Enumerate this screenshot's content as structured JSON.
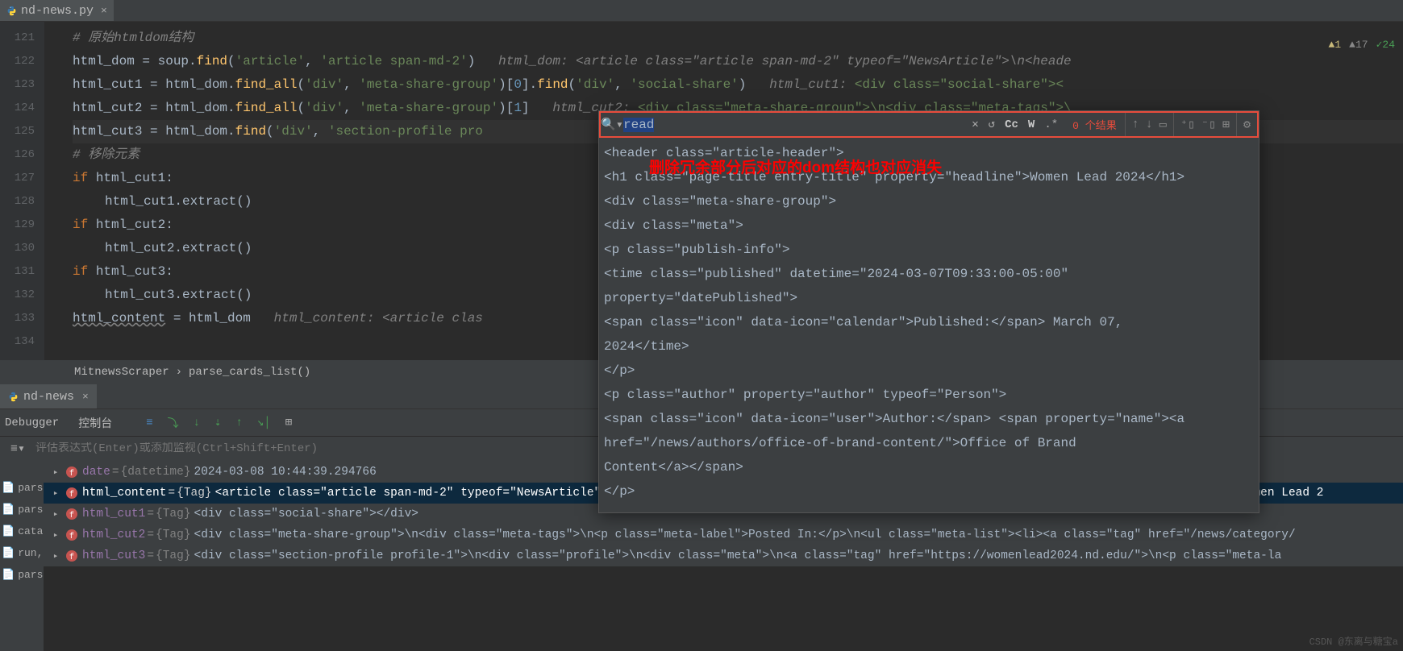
{
  "tab": {
    "name": "nd-news.py"
  },
  "status": {
    "warn1": "1",
    "warn2": "17",
    "ok": "24"
  },
  "gutter": [
    "121",
    "122",
    "123",
    "124",
    "125",
    "126",
    "127",
    "128",
    "129",
    "130",
    "131",
    "132",
    "133",
    "134"
  ],
  "code": {
    "l121": "# 原始htmldom结构",
    "l122a": "html_dom = soup.",
    "l122b": "find",
    "l122c": "(",
    "l122d": "'article'",
    "l122e": ", ",
    "l122f": "'article span-md-2'",
    "l122g": ")",
    "l122h": "html_dom: <article class=\"article span-md-2\" typeof=\"NewsArticle\">\\n<heade",
    "l123a": "html_cut1 = html_dom.",
    "l123b": "find_all",
    "l123c": "(",
    "l123d": "'div'",
    "l123e": ", ",
    "l123f": "'meta-share-group'",
    "l123g": ")[",
    "l123h": "0",
    "l123i": "].",
    "l123j": "find",
    "l123k": "(",
    "l123l": "'div'",
    "l123m": ", ",
    "l123n": "'social-share'",
    "l123o": ")",
    "l123p": "html_cut1: ",
    "l123q": "<div class=\"social-share\"><",
    "l124a": "html_cut2 = html_dom.",
    "l124b": "find_all",
    "l124c": "(",
    "l124d": "'div'",
    "l124e": ", ",
    "l124f": "'meta-share-group'",
    "l124g": ")[",
    "l124h": "1",
    "l124i": "]",
    "l124j": "html_cut2: ",
    "l124k": "<div class=\"meta-share-group\">\\n<div class=\"meta-tags\">\\",
    "l125a": "html_cut3 = html_dom.",
    "l125b": "find",
    "l125c": "(",
    "l125d": "'div'",
    "l125e": ", ",
    "l125f": "'section-profile pro",
    "l126": "# 移除元素",
    "l127a": "if ",
    "l127b": "html_cut1:",
    "l128": "html_cut1.extract()",
    "l129a": "if ",
    "l129b": "html_cut2:",
    "l130": "html_cut2.extract()",
    "l131a": "if ",
    "l131b": "html_cut3:",
    "l132": "html_cut3.extract()",
    "l133a": "html_content",
    "l133b": " = html_dom",
    "l133c": "html_content: <article clas"
  },
  "crumbs": {
    "a": "MitnewsScraper",
    "sep": "›",
    "b": "parse_cards_list()"
  },
  "dbg": {
    "tab": "nd-news",
    "debugger": "Debugger",
    "console": "控制台"
  },
  "eval": {
    "ph": "评估表达式(Enter)或添加监视(Ctrl+Shift+Enter)"
  },
  "sidetabs": [
    "pars",
    "pars",
    "cata",
    "run,",
    "pars"
  ],
  "vars": [
    {
      "name": "date",
      "type": "{datetime}",
      "val": "2024-03-08 10:44:39.294766"
    },
    {
      "name": "html_content",
      "type": "{Tag}",
      "val": "<article class=\"article span-md-2\" typeof=\"NewsArticle\">\\n<header class=\"article-header\">\\n<h1 class=\"page-title entry-title\" property=\"headline\">Women Lead 2"
    },
    {
      "name": "html_cut1",
      "type": "{Tag}",
      "val": "<div class=\"social-share\"></div>"
    },
    {
      "name": "html_cut2",
      "type": "{Tag}",
      "val": "<div class=\"meta-share-group\">\\n<div class=\"meta-tags\">\\n<p class=\"meta-label\">Posted In:</p>\\n<ul class=\"meta-list\"><li><a class=\"tag\" href=\"/news/category/"
    },
    {
      "name": "html_cut3",
      "type": "{Tag}",
      "val": "<div class=\"section-profile profile-1\">\\n<div class=\"profile\">\\n<div class=\"meta\">\\n<a class=\"tag\" href=\"https://womenlead2024.nd.edu/\">\\n<p class=\"meta-la"
    }
  ],
  "popup": {
    "search": "read",
    "count": "0 个结果",
    "cc": "Cc",
    "w": "W",
    "re": ".*",
    "ann": "删除冗余部分后对应的dom结构也对应消失",
    "body": [
      "<header class=\"article-header\">",
      "<h1 class=\"page-title entry-title\" property=\"headline\">Women Lead 2024</h1>",
      "<div class=\"meta-share-group\">",
      "<div class=\"meta\">",
      "<p class=\"publish-info\">",
      "<time class=\"published\" datetime=\"2024-03-07T09:33:00-05:00\"",
      " property=\"datePublished\">",
      "<span class=\"icon\" data-icon=\"calendar\">Published:</span> March 07, ",
      "2024</time>",
      "</p>",
      "<p class=\"author\" property=\"author\" typeof=\"Person\">",
      "<span class=\"icon\" data-icon=\"user\">Author:</span> <span property=\"name\"><a",
      " href=\"/news/authors/office-of-brand-content/\">Office of Brand ",
      "Content</a></span>",
      "</p>"
    ]
  },
  "watermark": "CSDN @东离与糖宝a"
}
